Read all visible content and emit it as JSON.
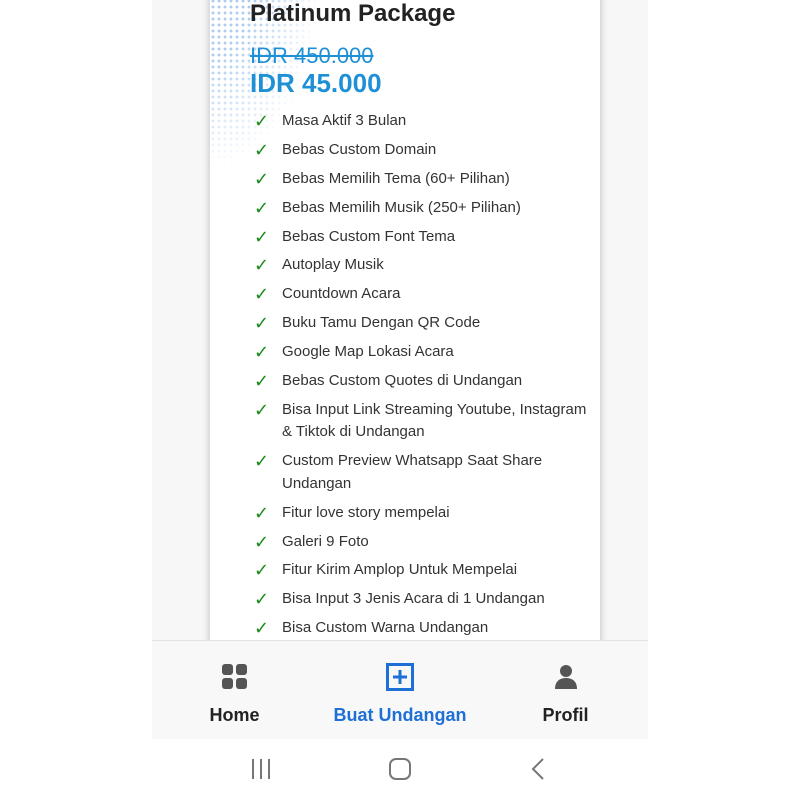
{
  "package": {
    "title": "Platinum Package",
    "old_price": "IDR 450.000",
    "new_price": "IDR 45.000"
  },
  "features": [
    "Masa Aktif 3 Bulan",
    "Bebas Custom Domain",
    "Bebas Memilih Tema (60+ Pilihan)",
    "Bebas Memilih Musik (250+ Pilihan)",
    "Bebas Custom Font Tema",
    "Autoplay Musik",
    "Countdown Acara",
    "Buku Tamu Dengan QR Code",
    "Google Map Lokasi Acara",
    "Bebas Custom Quotes di Undangan",
    "Bisa Input Link Streaming Youtube, Instagram & Tiktok di Undangan",
    "Custom Preview Whatsapp Saat Share Undangan",
    "Fitur love story mempelai",
    "Galeri 9 Foto",
    "Fitur Kirim Amplop Untuk Mempelai",
    "Bisa Input 3 Jenis Acara di 1 Undangan",
    "Bisa Custom Warna Undangan"
  ],
  "check_symbol": "✓",
  "bottom_nav": {
    "items": [
      {
        "label": "Home",
        "icon": "grid-icon"
      },
      {
        "label": "Buat Undangan",
        "icon": "plus-square-icon",
        "active": true
      },
      {
        "label": "Profil",
        "icon": "user-icon"
      }
    ]
  },
  "colors": {
    "accent_blue": "#1e90d6",
    "active_nav": "#1e6fd6",
    "check_green": "#1a8a1a"
  }
}
